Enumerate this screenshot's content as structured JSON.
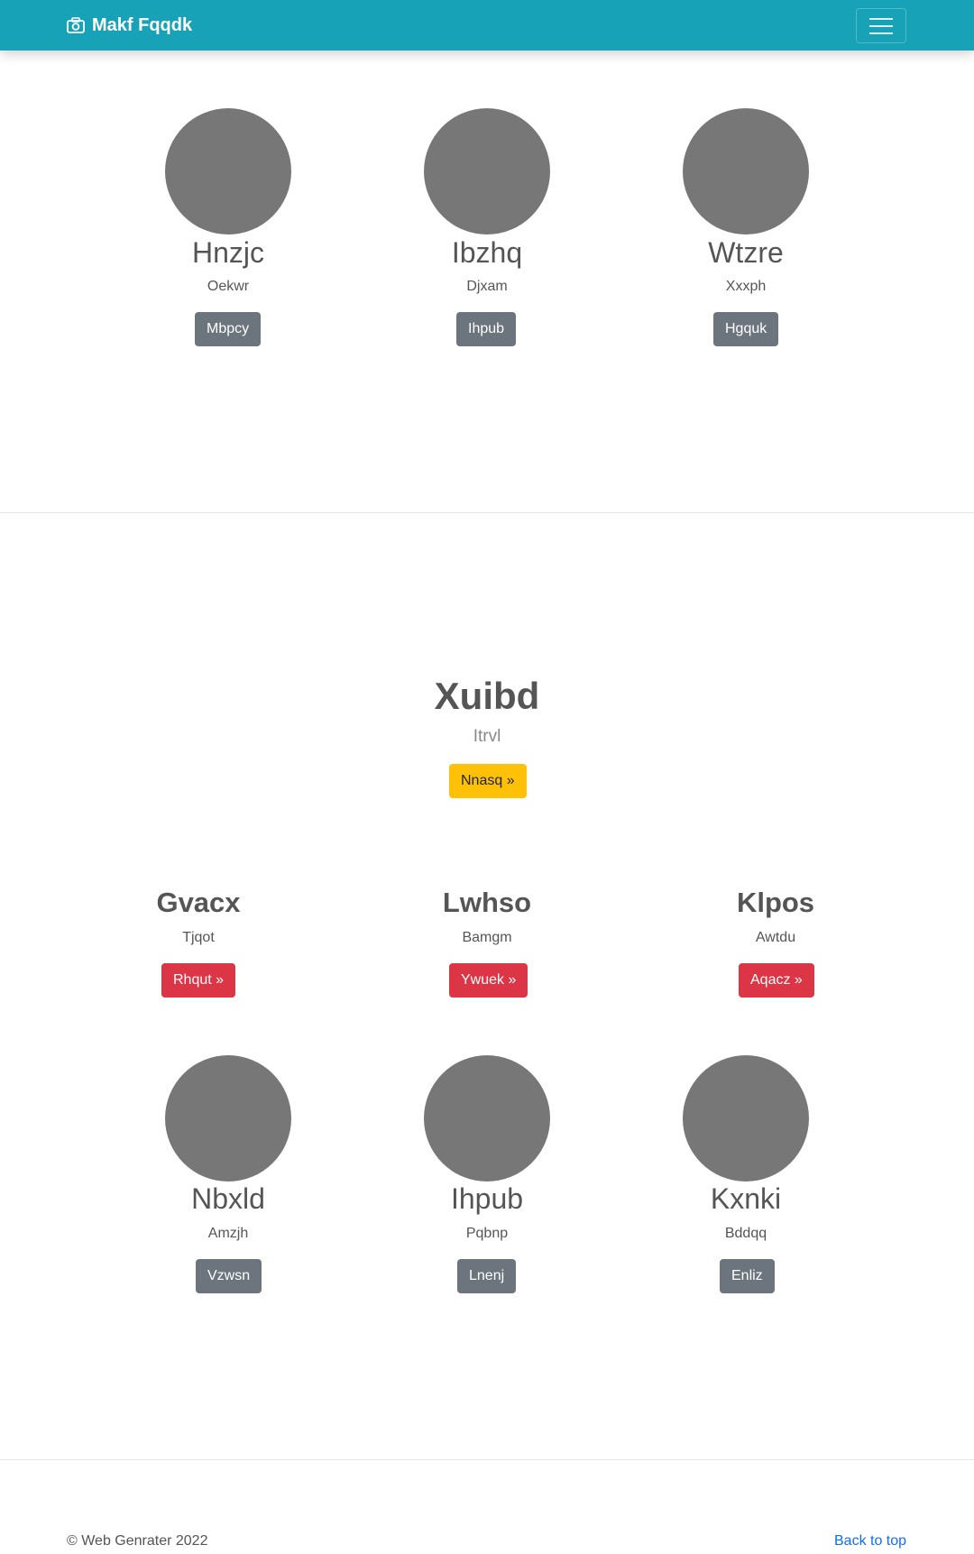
{
  "navbar": {
    "brand": "Makf Fqqdk",
    "brand_icon": "camera-icon",
    "toggle_icon": "menu-icon"
  },
  "top_cards": [
    {
      "name": "Hnzjc",
      "sub": "Oekwr",
      "button": "Mbpcy"
    },
    {
      "name": "Ibzhq",
      "sub": "Djxam",
      "button": "Ihpub"
    },
    {
      "name": "Wtzre",
      "sub": "Xxxph",
      "button": "Hgquk"
    }
  ],
  "hero": {
    "title": "Xuibd",
    "subtitle": "Itrvl",
    "button": "Nnasq »"
  },
  "features": [
    {
      "title": "Gvacx",
      "sub": "Tjqot",
      "button": "Rhqut »"
    },
    {
      "title": "Lwhso",
      "sub": "Bamgm",
      "button": "Ywuek »"
    },
    {
      "title": "Klpos",
      "sub": "Awtdu",
      "button": "Aqacz »"
    }
  ],
  "bottom_cards": [
    {
      "name": "Nbxld",
      "sub": "Amzjh",
      "button": "Vzwsn"
    },
    {
      "name": "Ihpub",
      "sub": "Pqbnp",
      "button": "Lnenj"
    },
    {
      "name": "Kxnki",
      "sub": "Bddqq",
      "button": "Enliz"
    }
  ],
  "footer": {
    "copyright": "© Web Genrater 2022",
    "back_to_top": "Back to top"
  },
  "colors": {
    "navbar": "#17a2b8",
    "avatar": "#777777",
    "button_secondary": "#6c757d",
    "button_danger": "#dc3545",
    "button_warning": "#ffc107",
    "link": "#0d6efd"
  }
}
